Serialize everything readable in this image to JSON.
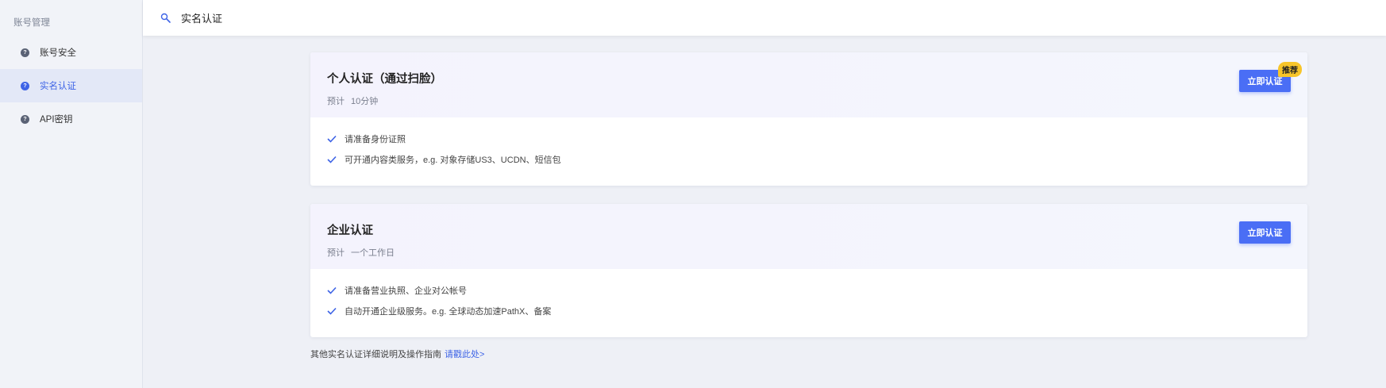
{
  "sidebar": {
    "title": "账号管理",
    "items": [
      {
        "label": "账号安全",
        "icon": "info-icon",
        "active": false
      },
      {
        "label": "实名认证",
        "icon": "info-icon",
        "active": true
      },
      {
        "label": "API密钥",
        "icon": "info-icon",
        "active": false
      }
    ]
  },
  "header": {
    "icon": "search-icon",
    "title": "实名认证"
  },
  "cards": [
    {
      "title": "个人认证（通过扫脸）",
      "eta_label": "预计",
      "eta_value": "10分钟",
      "button": "立即认证",
      "badge": "推荐",
      "features": [
        "请准备身份证照",
        "可开通内容类服务，e.g. 对象存储US3、UCDN、短信包"
      ]
    },
    {
      "title": "企业认证",
      "eta_label": "预计",
      "eta_value": "一个工作日",
      "button": "立即认证",
      "features": [
        "请准备营业执照、企业对公帐号",
        "自动开通企业级服务。e.g. 全球动态加速PathX、备案"
      ]
    }
  ],
  "footer": {
    "text": "其他实名认证详细说明及操作指南",
    "link": "请戳此处>"
  },
  "colors": {
    "accent": "#4a6ef5",
    "badge": "#f7c52a",
    "active_text": "#3d63e6"
  }
}
